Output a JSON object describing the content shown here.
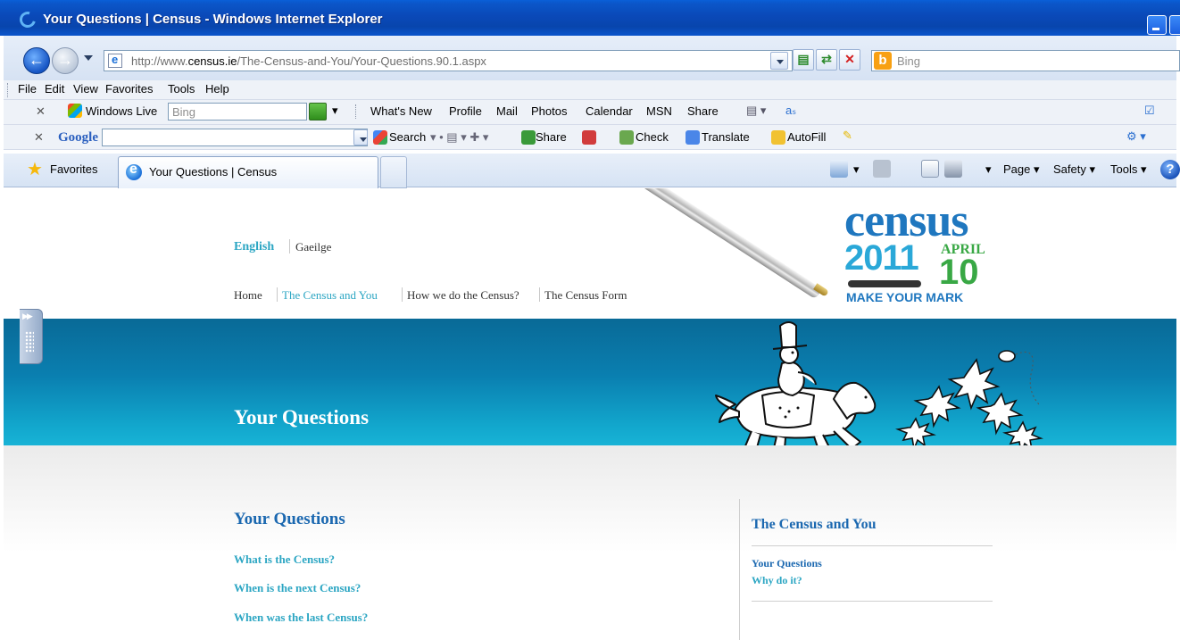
{
  "window": {
    "title": "Your Questions | Census - Windows Internet Explorer"
  },
  "address": {
    "url_prefix": "http://www.",
    "url_domain": "census.ie",
    "url_path": "/The-Census-and-You/Your-Questions.90.1.aspx",
    "search_placeholder": "Bing"
  },
  "menubar": {
    "items": [
      "File",
      "Edit",
      "View",
      "Favorites",
      "Tools",
      "Help"
    ]
  },
  "live_toolbar": {
    "brand": "Windows Live",
    "search_placeholder": "Bing",
    "items": [
      "What's New",
      "Profile",
      "Mail",
      "Photos",
      "Calendar",
      "MSN",
      "Share"
    ]
  },
  "google_toolbar": {
    "brand": "Google",
    "items": [
      "Search",
      "Share",
      "Check",
      "Translate",
      "AutoFill"
    ]
  },
  "tabs": {
    "favorites": "Favorites",
    "active": "Your Questions | Census"
  },
  "command_bar": {
    "items": [
      "Page",
      "Safety",
      "Tools"
    ]
  },
  "site": {
    "lang_en": "English",
    "lang_ga": "Gaeilge",
    "nav": [
      "Home",
      "The Census and You",
      "How we do the Census?",
      "The Census Form"
    ],
    "logo": {
      "word": "census",
      "year": "2011",
      "month": "APRIL",
      "day": "10",
      "tagline": "MAKE YOUR MARK"
    },
    "banner_title": "Your Questions",
    "main_heading": "Your Questions",
    "questions": [
      "What is the Census?",
      "When is the next Census?",
      "When was the last Census?"
    ],
    "sidebar": {
      "heading": "The Census and You",
      "links": [
        "Your Questions",
        "Why do it?"
      ]
    }
  },
  "colors": {
    "title_blue": "#0a49b8",
    "link_teal": "#2ca6c3",
    "heading_blue": "#1b68b0",
    "banner_blue": "#0a7fb0",
    "logo_green": "#39a845"
  }
}
